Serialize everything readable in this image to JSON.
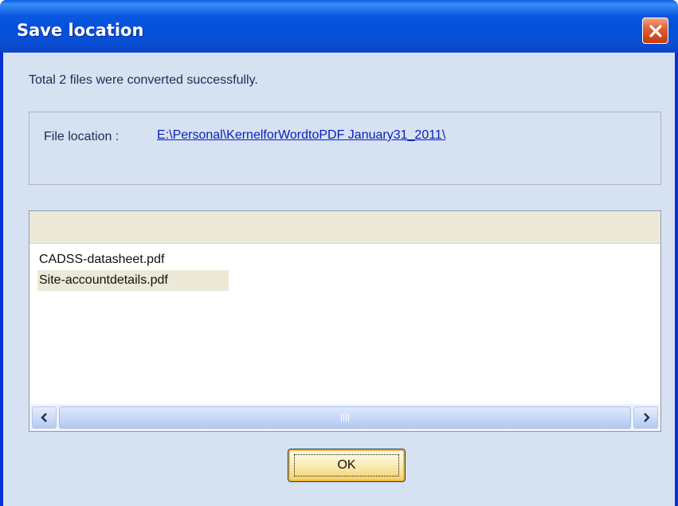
{
  "window": {
    "title": "Save location",
    "close_icon": "close-icon"
  },
  "status": {
    "message": "Total 2 files were converted successfully."
  },
  "file_location": {
    "label": "File location :",
    "path": "E:\\Personal\\KernelforWordtoPDF January31_2011\\"
  },
  "file_list": {
    "items": [
      {
        "name": "CADSS-datasheet.pdf",
        "selected": false
      },
      {
        "name": "Site-accountdetails.pdf",
        "selected": true
      }
    ]
  },
  "scrollbar": {
    "left_icon": "chevron-left-icon",
    "right_icon": "chevron-right-icon"
  },
  "buttons": {
    "ok_label": "OK"
  },
  "colors": {
    "titlebar": "#0a58e0",
    "client_bg": "#d6e2f2",
    "link": "#0b1fb5",
    "close_btn": "#d44a1c",
    "ok_btn": "#f7df8e"
  }
}
